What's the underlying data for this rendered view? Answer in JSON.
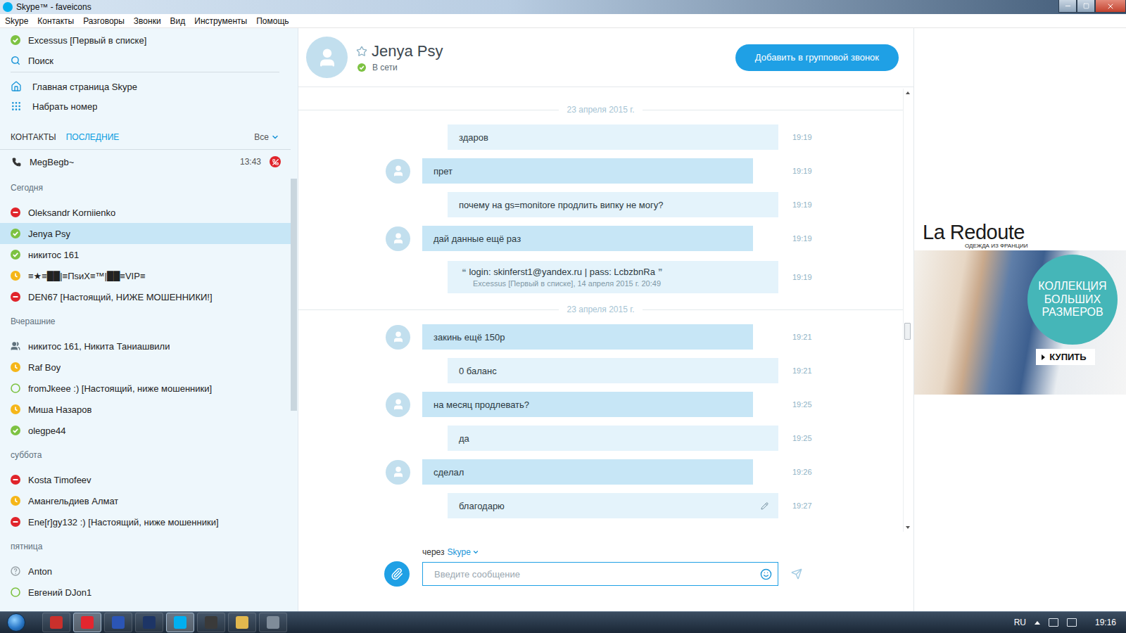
{
  "window": {
    "title": "Skype™ - faveicons"
  },
  "menu": [
    "Skype",
    "Контакты",
    "Разговоры",
    "Звонки",
    "Вид",
    "Инструменты",
    "Помощь"
  ],
  "sidebar": {
    "profile": {
      "name": "Excessus [Первый в списке]",
      "status": "online"
    },
    "search": "Поиск",
    "links": [
      "Главная страница Skype",
      "Набрать номер"
    ],
    "tabs": [
      {
        "label": "КОНТАКТЫ",
        "selected": false
      },
      {
        "label": "ПОСЛЕДНИЕ",
        "selected": true
      }
    ],
    "filter": "Все",
    "active_call": {
      "name": "MegBegb~",
      "time": "13:43"
    },
    "scroll_level": 0.04,
    "sections": [
      {
        "title": "Сегодня",
        "items": [
          {
            "name": "Oleksandr Korniienko",
            "kind": "contact",
            "status": "busy",
            "selected": false
          },
          {
            "name": "Jenya Psy",
            "kind": "contact",
            "status": "online",
            "selected": true
          },
          {
            "name": "никитос 161",
            "kind": "contact",
            "status": "online",
            "selected": false
          },
          {
            "name": "≡★≡██|≡ПsиХ≡™|██≡VIP≡",
            "kind": "contact",
            "status": "away",
            "selected": false
          },
          {
            "name": "DEN67 [Настоящий, НИЖЕ МОШЕННИКИ!]",
            "kind": "contact",
            "status": "busy",
            "selected": false
          }
        ]
      },
      {
        "title": "Вчерашние",
        "items": [
          {
            "name": "никитос 161, Никита Таниашвили",
            "kind": "group",
            "status": "none",
            "selected": false
          },
          {
            "name": "Raf Boy",
            "kind": "contact",
            "status": "away",
            "selected": false
          },
          {
            "name": "fromJkeee :) [Настоящий, ниже мошенники]",
            "kind": "contact",
            "status": "offline",
            "selected": false
          },
          {
            "name": "Миша Назаров",
            "kind": "contact",
            "status": "away",
            "selected": false
          },
          {
            "name": "olegpe44",
            "kind": "contact",
            "status": "online",
            "selected": false
          }
        ]
      },
      {
        "title": "суббота",
        "items": [
          {
            "name": "Kosta Timofeev",
            "kind": "contact",
            "status": "busy",
            "selected": false
          },
          {
            "name": "Амангельдиев Алмат",
            "kind": "contact",
            "status": "away",
            "selected": false
          },
          {
            "name": "Ene[r]gy132 :) [Настоящий, ниже мошенники]",
            "kind": "contact",
            "status": "busy",
            "selected": false
          }
        ]
      },
      {
        "title": "пятница",
        "items": [
          {
            "name": "Anton",
            "kind": "contact",
            "status": "unknown",
            "selected": false
          },
          {
            "name": "Евгений DJon1",
            "kind": "contact",
            "status": "offline",
            "selected": false
          }
        ]
      }
    ]
  },
  "chat": {
    "contact": {
      "name": "Jenya Psy",
      "status": "online",
      "status_text": "В сети",
      "favorite": false
    },
    "add_button": "Добавить в групповой звонок",
    "scroll_level": 0.55,
    "messages": [
      {
        "kind": "date",
        "text": "23 апреля 2015 г."
      },
      {
        "kind": "message",
        "own": true,
        "text": "здаров",
        "time": "19:19",
        "edited": false
      },
      {
        "kind": "message",
        "own": false,
        "text": "прет",
        "time": "19:19",
        "edited": false
      },
      {
        "kind": "message",
        "own": true,
        "text": "почему на gs=monitore продлить випку не могу?",
        "time": "19:19",
        "edited": false
      },
      {
        "kind": "message",
        "own": false,
        "text": "дай данные ещё раз",
        "time": "19:19",
        "edited": false
      },
      {
        "kind": "quote",
        "own": true,
        "open_mark": "❝",
        "text": "login: skinferst1@yandex.ru | pass: LcbzbnRa",
        "close_mark": "❞",
        "source": "Excessus [Первый в списке], 14 апреля 2015 г. 20:49",
        "time": "19:19",
        "edited": false
      },
      {
        "kind": "date",
        "text": "23 апреля 2015 г."
      },
      {
        "kind": "message",
        "own": false,
        "text": "закинь ещё 150р",
        "time": "19:21",
        "edited": false
      },
      {
        "kind": "message",
        "own": true,
        "text": "0 баланс",
        "time": "19:21",
        "edited": false
      },
      {
        "kind": "message",
        "own": false,
        "text": "на месяц продлевать?",
        "time": "19:25",
        "edited": false
      },
      {
        "kind": "message",
        "own": true,
        "text": "да",
        "time": "19:25",
        "edited": false
      },
      {
        "kind": "message",
        "own": false,
        "text": "сделал",
        "time": "19:26",
        "edited": false
      },
      {
        "kind": "message",
        "own": true,
        "text": "благодарю",
        "time": "19:27",
        "edited": true
      }
    ],
    "compose": {
      "via_label": "через",
      "via": "Skype",
      "placeholder": "Введите сообщение"
    }
  },
  "ad": {
    "brand": "La Redoute",
    "tagline": "ОДЕЖДА ИЗ ФРАНЦИИ",
    "badge": "КОЛЛЕКЦИЯ БОЛЬШИХ РАЗМЕРОВ",
    "button": "КУПИТЬ"
  },
  "taskbar": {
    "apps": [
      {
        "color": "#c9302c",
        "selected": false
      },
      {
        "color": "#e3262f",
        "selected": true
      },
      {
        "color": "#2b55b5",
        "selected": false
      },
      {
        "color": "#1d3566",
        "selected": false
      },
      {
        "color": "#00aff0",
        "selected": true
      },
      {
        "color": "#3a3a3a",
        "selected": false
      },
      {
        "color": "#e2b84e",
        "selected": false
      },
      {
        "color": "#7f8c99",
        "selected": false
      }
    ],
    "language": "RU",
    "clock": "19:16"
  }
}
